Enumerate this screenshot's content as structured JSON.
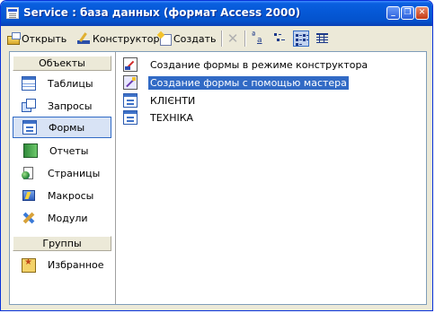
{
  "window": {
    "title": "Service : база данных (формат Access 2000)"
  },
  "toolbar": {
    "open_label": "Открыть",
    "design_label": "Конструктор",
    "create_label": "Создать"
  },
  "sidebar": {
    "objects_header": "Объекты",
    "items": [
      {
        "label": "Таблицы",
        "icon": "table-icon"
      },
      {
        "label": "Запросы",
        "icon": "query-icon"
      },
      {
        "label": "Формы",
        "icon": "form-icon",
        "selected": true
      },
      {
        "label": "Отчеты",
        "icon": "report-icon"
      },
      {
        "label": "Страницы",
        "icon": "page-icon"
      },
      {
        "label": "Макросы",
        "icon": "macro-icon"
      },
      {
        "label": "Модули",
        "icon": "module-icon"
      }
    ],
    "groups_header": "Группы",
    "groups": [
      {
        "label": "Избранное",
        "icon": "favorites-folder-icon"
      }
    ]
  },
  "content": {
    "items": [
      {
        "label": "Создание формы в режиме конструктора",
        "icon": "new-design-icon"
      },
      {
        "label": "Создание формы с помощью мастера",
        "icon": "wizard-icon",
        "selected": true
      },
      {
        "label": "КЛІЄНТИ",
        "icon": "form-icon"
      },
      {
        "label": "ТЕХНІКА",
        "icon": "form-icon"
      }
    ]
  },
  "colors": {
    "titlebar": "#0558d6",
    "selection": "#316ac5",
    "window_bg": "#ece9d8"
  }
}
